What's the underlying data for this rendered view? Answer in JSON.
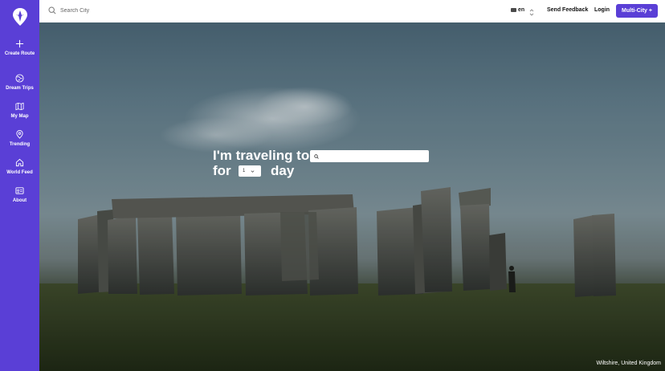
{
  "sidebar": {
    "items": [
      {
        "label": "Create Route",
        "icon": "plus-icon"
      },
      {
        "label": "Dream Trips",
        "icon": "globe-icon"
      },
      {
        "label": "My Map",
        "icon": "map-icon"
      },
      {
        "label": "Trending",
        "icon": "pin-icon"
      },
      {
        "label": "World Feed",
        "icon": "home-icon"
      },
      {
        "label": "About",
        "icon": "id-card-icon"
      }
    ],
    "logo_icon": "compass-pin-logo"
  },
  "topbar": {
    "search_placeholder": "Search City",
    "language": "en",
    "send_feedback": "Send Feedback",
    "login": "Login",
    "multi_city": "Multi-City +"
  },
  "hero": {
    "line1": "I'm traveling to",
    "line2": "for",
    "days_value": "1",
    "day_label": "day",
    "location": "Wiltshire, United Kingdom"
  },
  "colors": {
    "accent": "#5a3fd6",
    "topbar_bg": "#ffffff",
    "text_on_accent": "#ffffff"
  }
}
